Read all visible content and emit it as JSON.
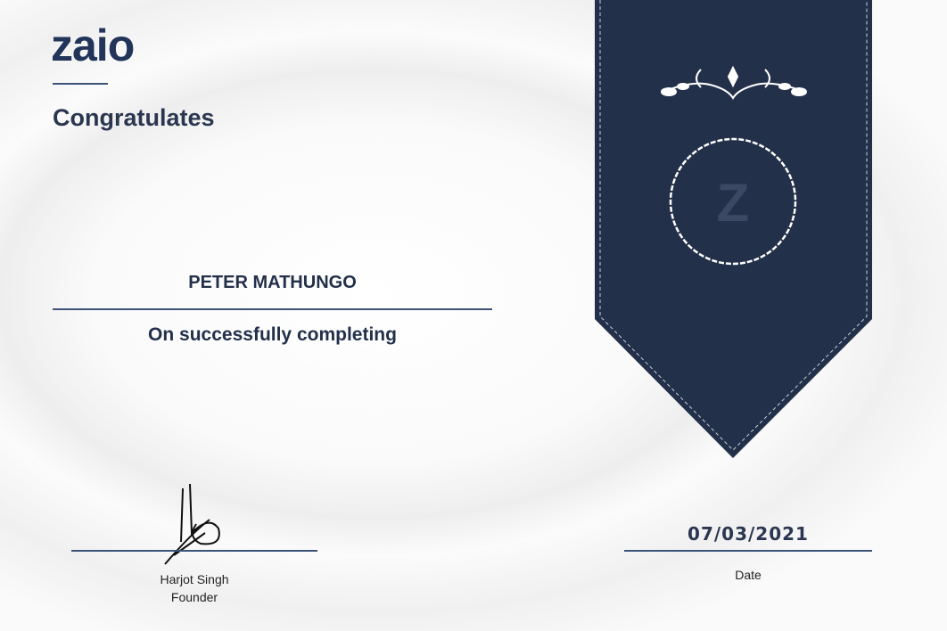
{
  "logo": "zaio",
  "heading": "Congratulates",
  "recipient_name": "PETER MATHUNGO",
  "subtitle": "On successfully completing",
  "signatory": {
    "name": "Harjot Singh",
    "title": "Founder"
  },
  "date": {
    "value": "07/03/2021",
    "label": "Date"
  },
  "colors": {
    "navy": "#223049",
    "accent": "#3d5378"
  }
}
